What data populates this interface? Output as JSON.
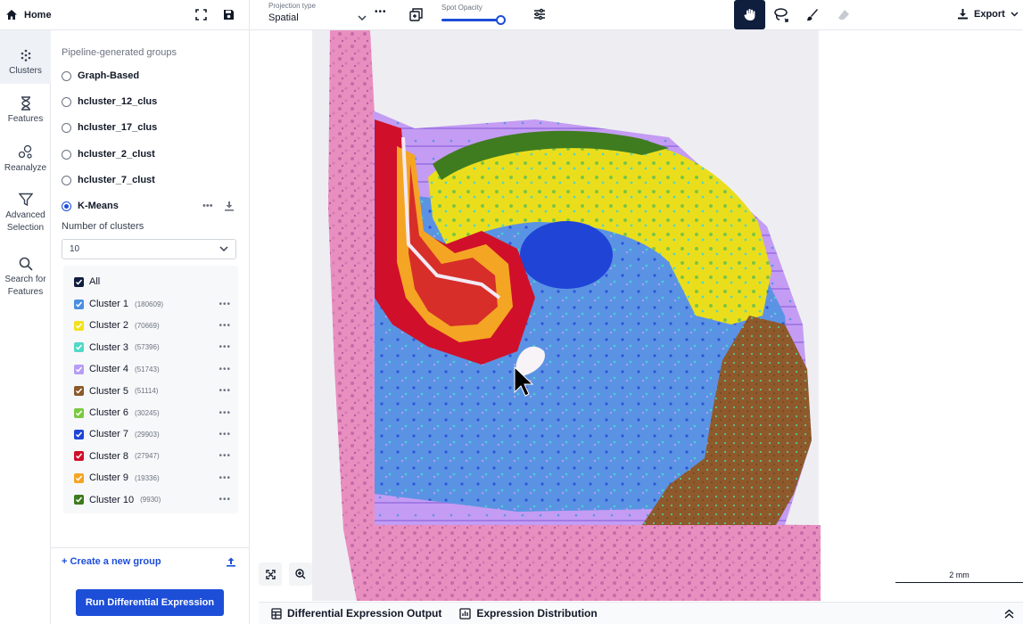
{
  "home": {
    "label": "Home"
  },
  "rail": {
    "items": [
      {
        "label": "Clusters"
      },
      {
        "label": "Features"
      },
      {
        "label": "Reanalyze"
      },
      {
        "label": "Advanced Selection"
      },
      {
        "label": "Search for Features"
      }
    ]
  },
  "panel": {
    "section_title": "Pipeline-generated groups",
    "groups": [
      {
        "label": "Graph-Based",
        "selected": false
      },
      {
        "label": "hcluster_12_clus",
        "selected": false
      },
      {
        "label": "hcluster_17_clus",
        "selected": false
      },
      {
        "label": "hcluster_2_clust",
        "selected": false
      },
      {
        "label": "hcluster_7_clust",
        "selected": false
      },
      {
        "label": "K-Means",
        "selected": true
      }
    ],
    "num_clusters_label": "Number of clusters",
    "num_clusters_value": "10",
    "all_label": "All",
    "clusters": [
      {
        "label": "Cluster 1",
        "count": "(180609)",
        "color": "#4a8fe0"
      },
      {
        "label": "Cluster 2",
        "count": "(70669)",
        "color": "#f2e21b"
      },
      {
        "label": "Cluster 3",
        "count": "(57396)",
        "color": "#4fd9c8"
      },
      {
        "label": "Cluster 4",
        "count": "(51743)",
        "color": "#b79cf5"
      },
      {
        "label": "Cluster 5",
        "count": "(51114)",
        "color": "#8b5a2b"
      },
      {
        "label": "Cluster 6",
        "count": "(30245)",
        "color": "#7bc943"
      },
      {
        "label": "Cluster 7",
        "count": "(29903)",
        "color": "#1f44d6"
      },
      {
        "label": "Cluster 8",
        "count": "(27947)",
        "color": "#d0102a"
      },
      {
        "label": "Cluster 9",
        "count": "(19336)",
        "color": "#f5a524"
      },
      {
        "label": "Cluster 10",
        "count": "(9930)",
        "color": "#3d7a1f"
      }
    ],
    "create_group_label": "+ Create a new group",
    "run_button_label": "Run Differential Expression"
  },
  "toolbar": {
    "projection_label": "Projection type",
    "projection_value": "Spatial",
    "opacity_label": "Spot Opacity",
    "opacity_value": 0.92,
    "export_label": "Export"
  },
  "canvas": {
    "scale_label": "2 mm"
  },
  "bottom": {
    "tab1": "Differential Expression Output",
    "tab2": "Expression Distribution"
  }
}
